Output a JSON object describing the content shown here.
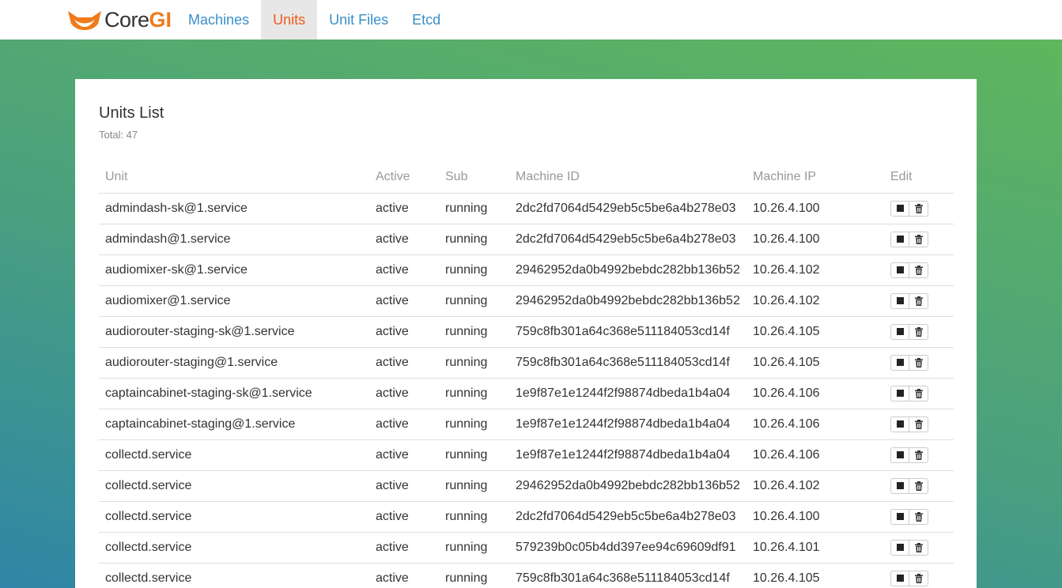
{
  "brand": {
    "core": "Core",
    "gi": "GI",
    "logo_icon": "fox-logo-icon",
    "accent_color": "#f07a1a"
  },
  "nav": {
    "items": [
      {
        "label": "Machines",
        "active": false
      },
      {
        "label": "Units",
        "active": true
      },
      {
        "label": "Unit Files",
        "active": false
      },
      {
        "label": "Etcd",
        "active": false
      }
    ]
  },
  "panel": {
    "title": "Units List",
    "total": "Total: 47"
  },
  "table": {
    "headers": [
      "Unit",
      "Active",
      "Sub",
      "Machine ID",
      "Machine IP",
      "Edit"
    ],
    "rows": [
      [
        "admindash-sk@1.service",
        "active",
        "running",
        "2dc2fd7064d5429eb5c5be6a4b278e03",
        "10.26.4.100"
      ],
      [
        "admindash@1.service",
        "active",
        "running",
        "2dc2fd7064d5429eb5c5be6a4b278e03",
        "10.26.4.100"
      ],
      [
        "audiomixer-sk@1.service",
        "active",
        "running",
        "29462952da0b4992bebdc282bb136b52",
        "10.26.4.102"
      ],
      [
        "audiomixer@1.service",
        "active",
        "running",
        "29462952da0b4992bebdc282bb136b52",
        "10.26.4.102"
      ],
      [
        "audiorouter-staging-sk@1.service",
        "active",
        "running",
        "759c8fb301a64c368e511184053cd14f",
        "10.26.4.105"
      ],
      [
        "audiorouter-staging@1.service",
        "active",
        "running",
        "759c8fb301a64c368e511184053cd14f",
        "10.26.4.105"
      ],
      [
        "captaincabinet-staging-sk@1.service",
        "active",
        "running",
        "1e9f87e1e1244f2f98874dbeda1b4a04",
        "10.26.4.106"
      ],
      [
        "captaincabinet-staging@1.service",
        "active",
        "running",
        "1e9f87e1e1244f2f98874dbeda1b4a04",
        "10.26.4.106"
      ],
      [
        "collectd.service",
        "active",
        "running",
        "1e9f87e1e1244f2f98874dbeda1b4a04",
        "10.26.4.106"
      ],
      [
        "collectd.service",
        "active",
        "running",
        "29462952da0b4992bebdc282bb136b52",
        "10.26.4.102"
      ],
      [
        "collectd.service",
        "active",
        "running",
        "2dc2fd7064d5429eb5c5be6a4b278e03",
        "10.26.4.100"
      ],
      [
        "collectd.service",
        "active",
        "running",
        "579239b0c05b4dd397ee94c69609df91",
        "10.26.4.101"
      ],
      [
        "collectd.service",
        "active",
        "running",
        "759c8fb301a64c368e511184053cd14f",
        "10.26.4.105"
      ]
    ],
    "edit_icons": [
      "stop-icon",
      "trash-icon"
    ]
  }
}
